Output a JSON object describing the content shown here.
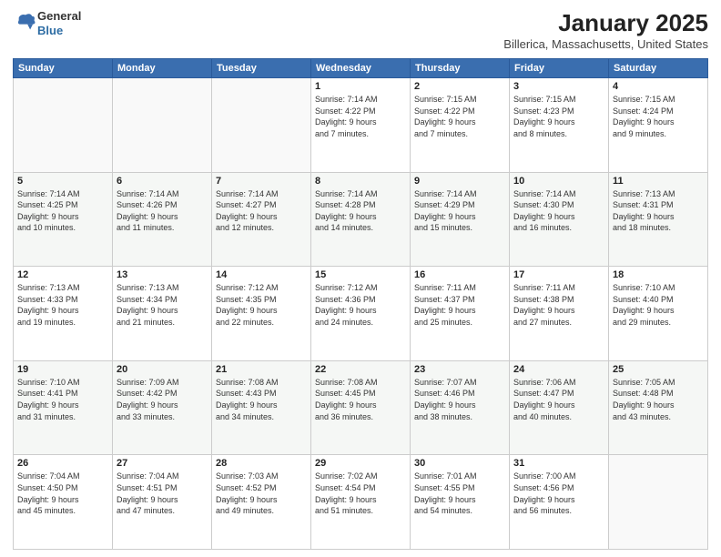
{
  "header": {
    "logo_line1": "General",
    "logo_line2": "Blue",
    "title": "January 2025",
    "location": "Billerica, Massachusetts, United States"
  },
  "weekdays": [
    "Sunday",
    "Monday",
    "Tuesday",
    "Wednesday",
    "Thursday",
    "Friday",
    "Saturday"
  ],
  "weeks": [
    [
      {
        "day": "",
        "info": ""
      },
      {
        "day": "",
        "info": ""
      },
      {
        "day": "",
        "info": ""
      },
      {
        "day": "1",
        "info": "Sunrise: 7:14 AM\nSunset: 4:22 PM\nDaylight: 9 hours\nand 7 minutes."
      },
      {
        "day": "2",
        "info": "Sunrise: 7:15 AM\nSunset: 4:22 PM\nDaylight: 9 hours\nand 7 minutes."
      },
      {
        "day": "3",
        "info": "Sunrise: 7:15 AM\nSunset: 4:23 PM\nDaylight: 9 hours\nand 8 minutes."
      },
      {
        "day": "4",
        "info": "Sunrise: 7:15 AM\nSunset: 4:24 PM\nDaylight: 9 hours\nand 9 minutes."
      }
    ],
    [
      {
        "day": "5",
        "info": "Sunrise: 7:14 AM\nSunset: 4:25 PM\nDaylight: 9 hours\nand 10 minutes."
      },
      {
        "day": "6",
        "info": "Sunrise: 7:14 AM\nSunset: 4:26 PM\nDaylight: 9 hours\nand 11 minutes."
      },
      {
        "day": "7",
        "info": "Sunrise: 7:14 AM\nSunset: 4:27 PM\nDaylight: 9 hours\nand 12 minutes."
      },
      {
        "day": "8",
        "info": "Sunrise: 7:14 AM\nSunset: 4:28 PM\nDaylight: 9 hours\nand 14 minutes."
      },
      {
        "day": "9",
        "info": "Sunrise: 7:14 AM\nSunset: 4:29 PM\nDaylight: 9 hours\nand 15 minutes."
      },
      {
        "day": "10",
        "info": "Sunrise: 7:14 AM\nSunset: 4:30 PM\nDaylight: 9 hours\nand 16 minutes."
      },
      {
        "day": "11",
        "info": "Sunrise: 7:13 AM\nSunset: 4:31 PM\nDaylight: 9 hours\nand 18 minutes."
      }
    ],
    [
      {
        "day": "12",
        "info": "Sunrise: 7:13 AM\nSunset: 4:33 PM\nDaylight: 9 hours\nand 19 minutes."
      },
      {
        "day": "13",
        "info": "Sunrise: 7:13 AM\nSunset: 4:34 PM\nDaylight: 9 hours\nand 21 minutes."
      },
      {
        "day": "14",
        "info": "Sunrise: 7:12 AM\nSunset: 4:35 PM\nDaylight: 9 hours\nand 22 minutes."
      },
      {
        "day": "15",
        "info": "Sunrise: 7:12 AM\nSunset: 4:36 PM\nDaylight: 9 hours\nand 24 minutes."
      },
      {
        "day": "16",
        "info": "Sunrise: 7:11 AM\nSunset: 4:37 PM\nDaylight: 9 hours\nand 25 minutes."
      },
      {
        "day": "17",
        "info": "Sunrise: 7:11 AM\nSunset: 4:38 PM\nDaylight: 9 hours\nand 27 minutes."
      },
      {
        "day": "18",
        "info": "Sunrise: 7:10 AM\nSunset: 4:40 PM\nDaylight: 9 hours\nand 29 minutes."
      }
    ],
    [
      {
        "day": "19",
        "info": "Sunrise: 7:10 AM\nSunset: 4:41 PM\nDaylight: 9 hours\nand 31 minutes."
      },
      {
        "day": "20",
        "info": "Sunrise: 7:09 AM\nSunset: 4:42 PM\nDaylight: 9 hours\nand 33 minutes."
      },
      {
        "day": "21",
        "info": "Sunrise: 7:08 AM\nSunset: 4:43 PM\nDaylight: 9 hours\nand 34 minutes."
      },
      {
        "day": "22",
        "info": "Sunrise: 7:08 AM\nSunset: 4:45 PM\nDaylight: 9 hours\nand 36 minutes."
      },
      {
        "day": "23",
        "info": "Sunrise: 7:07 AM\nSunset: 4:46 PM\nDaylight: 9 hours\nand 38 minutes."
      },
      {
        "day": "24",
        "info": "Sunrise: 7:06 AM\nSunset: 4:47 PM\nDaylight: 9 hours\nand 40 minutes."
      },
      {
        "day": "25",
        "info": "Sunrise: 7:05 AM\nSunset: 4:48 PM\nDaylight: 9 hours\nand 43 minutes."
      }
    ],
    [
      {
        "day": "26",
        "info": "Sunrise: 7:04 AM\nSunset: 4:50 PM\nDaylight: 9 hours\nand 45 minutes."
      },
      {
        "day": "27",
        "info": "Sunrise: 7:04 AM\nSunset: 4:51 PM\nDaylight: 9 hours\nand 47 minutes."
      },
      {
        "day": "28",
        "info": "Sunrise: 7:03 AM\nSunset: 4:52 PM\nDaylight: 9 hours\nand 49 minutes."
      },
      {
        "day": "29",
        "info": "Sunrise: 7:02 AM\nSunset: 4:54 PM\nDaylight: 9 hours\nand 51 minutes."
      },
      {
        "day": "30",
        "info": "Sunrise: 7:01 AM\nSunset: 4:55 PM\nDaylight: 9 hours\nand 54 minutes."
      },
      {
        "day": "31",
        "info": "Sunrise: 7:00 AM\nSunset: 4:56 PM\nDaylight: 9 hours\nand 56 minutes."
      },
      {
        "day": "",
        "info": ""
      }
    ]
  ]
}
